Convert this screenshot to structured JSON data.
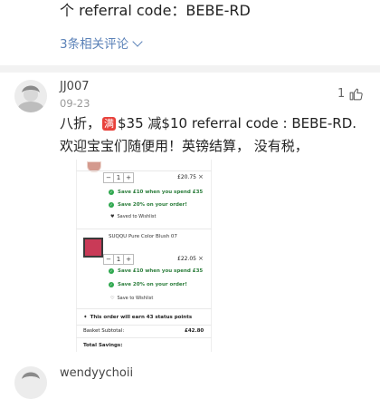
{
  "top_comment": {
    "text": "个 referral code：BEBE-RD",
    "related": "3条相关评论"
  },
  "comment": {
    "username": "JJ007",
    "date": "09-23",
    "likes": "1",
    "text_before_badge": "八折，",
    "badge": "满",
    "text_after_badge": "$35 减$10 referral code : BEBE-RD. 欢迎宝宝们随便用！英镑结算， 没有税，"
  },
  "screenshot": {
    "item1": {
      "qty": "1",
      "price": "£20.75",
      "remove": "×",
      "offer1": "Save £10 when you spend £35",
      "offer2": "Save 20% on your order!",
      "wishlist": "Saved to Wishlist"
    },
    "item2": {
      "title": "SUQQU Pure Color Blush 07",
      "qty": "1",
      "price": "£22.05",
      "remove": "×",
      "offer1": "Save £10 when you spend £35",
      "offer2": "Save 20% on your order!",
      "wishlist": "Save to Wishlist"
    },
    "status_points": "This order will earn 43 status points",
    "basket_subtotal_label": "Basket Subtotal:",
    "basket_subtotal_value": "£42.80",
    "total_savings_label": "Total Savings:"
  },
  "next_comment": {
    "username": "wendyychoii"
  },
  "colors": {
    "link": "#5b82b8",
    "badge_red": "#e8413b",
    "offer_green": "#2fa84f"
  }
}
